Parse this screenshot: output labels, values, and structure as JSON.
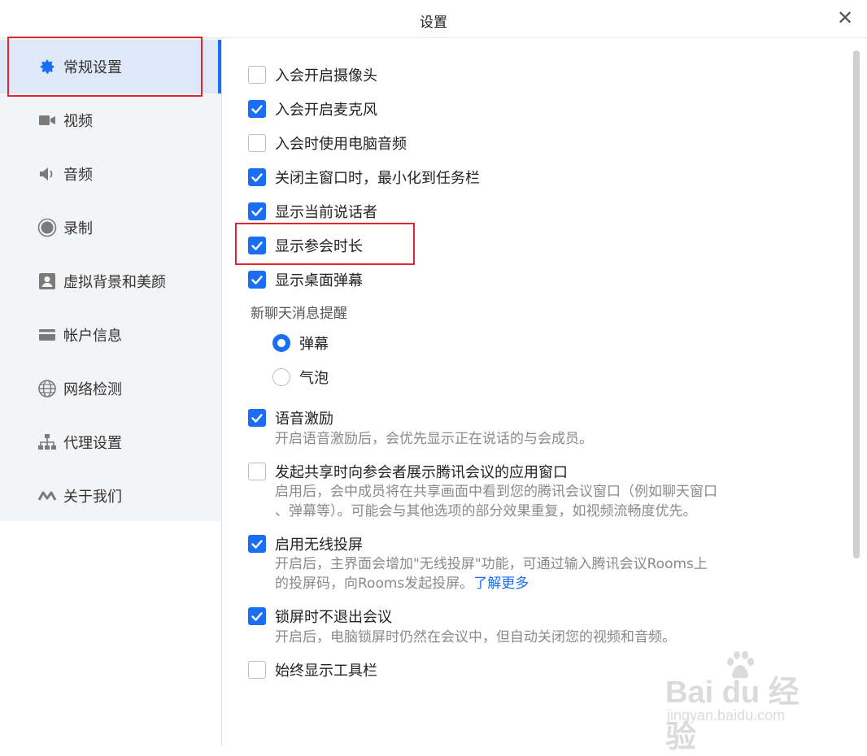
{
  "window": {
    "title": "设置",
    "close_glyph": "✕"
  },
  "sidebar": {
    "items": [
      {
        "label": "常规设置",
        "icon": "gear-icon",
        "active": true
      },
      {
        "label": "视频",
        "icon": "video-camera-icon"
      },
      {
        "label": "音频",
        "icon": "speaker-icon"
      },
      {
        "label": "录制",
        "icon": "record-icon"
      },
      {
        "label": "虚拟背景和美颜",
        "icon": "portrait-icon"
      },
      {
        "label": "帐户信息",
        "icon": "card-icon"
      },
      {
        "label": "网络检测",
        "icon": "globe-icon"
      },
      {
        "label": "代理设置",
        "icon": "network-tree-icon"
      },
      {
        "label": "关于我们",
        "icon": "logo-icon"
      }
    ]
  },
  "general": {
    "options": [
      {
        "label": "入会开启摄像头",
        "checked": false
      },
      {
        "label": "入会开启麦克风",
        "checked": true
      },
      {
        "label": "入会时使用电脑音频",
        "checked": false
      },
      {
        "label": "关闭主窗口时，最小化到任务栏",
        "checked": true
      },
      {
        "label": "显示当前说话者",
        "checked": true
      },
      {
        "label": "显示参会时长",
        "checked": true
      },
      {
        "label": "显示桌面弹幕",
        "checked": true
      }
    ],
    "chat_section": {
      "title": "新聊天消息提醒",
      "options": [
        {
          "label": "弹幕",
          "selected": true
        },
        {
          "label": "气泡",
          "selected": false
        }
      ]
    },
    "voice_excitation": {
      "label": "语音激励",
      "checked": true,
      "desc": "开启语音激励后，会优先显示正在说话的与会成员。"
    },
    "share_window": {
      "label": "发起共享时向参会者展示腾讯会议的应用窗口",
      "checked": false,
      "desc_line1": "启用后，会中成员将在共享画面中看到您的腾讯会议窗口（例如聊天窗口",
      "desc_line2": "、弹幕等）。可能会与其他选项的部分效果重复，如视频流畅度优先。"
    },
    "wireless": {
      "label": "启用无线投屏",
      "checked": true,
      "desc_line1": "开启后，主界面会增加\"无线投屏\"功能，可通过输入腾讯会议Rooms上",
      "desc_line2": "的投屏码，向Rooms发起投屏。",
      "link": "了解更多"
    },
    "lock_screen": {
      "label": "锁屏时不退出会议",
      "checked": true,
      "desc": "开启后，电脑锁屏时仍然在会议中，但自动关闭您的视频和音频。"
    },
    "toolbar": {
      "label": "始终显示工具栏",
      "checked": false
    }
  },
  "watermark": {
    "main": "Bai du 经验",
    "sub": "jingyan.baidu.com"
  },
  "colors": {
    "accent": "#1a6ef5",
    "highlight_border": "#e0262f",
    "sidebar_bg": "#f3f4f6"
  }
}
